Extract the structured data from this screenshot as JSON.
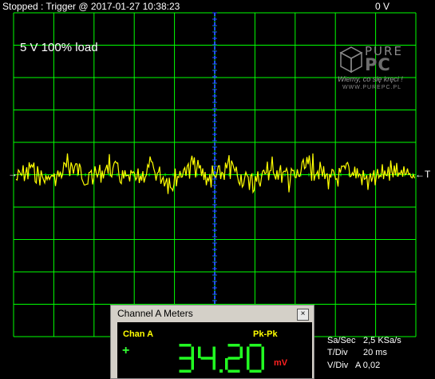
{
  "status": {
    "text": "Stopped : Trigger @ 2017-01-27 10:38:23",
    "trigger_level": "0 V"
  },
  "scope": {
    "annotation": "5 V 100% load",
    "grid_color": "#00ff00",
    "trace_color": "#ffff00",
    "center_axis_color": "#2050ff",
    "left_marker": "→",
    "right_marker": "←T"
  },
  "logo": {
    "line1": "PURE",
    "line2": "PC",
    "tagline": "Wiemy, co się kręci !",
    "url": "WWW.PUREPC.PL"
  },
  "meters": {
    "title": "Channel A Meters",
    "close": "×",
    "channel": "Chan A",
    "mode": "Pk-Pk",
    "sign": "+",
    "value": "34.20",
    "unit": "mV"
  },
  "info": {
    "sa_label": "Sa/Sec",
    "sa_value": "2,5 KSa/s",
    "tdiv_label": "T/Div",
    "tdiv_value": "20 ms",
    "vdiv_label": "V/Div",
    "vdiv_value": "A 0,02"
  }
}
